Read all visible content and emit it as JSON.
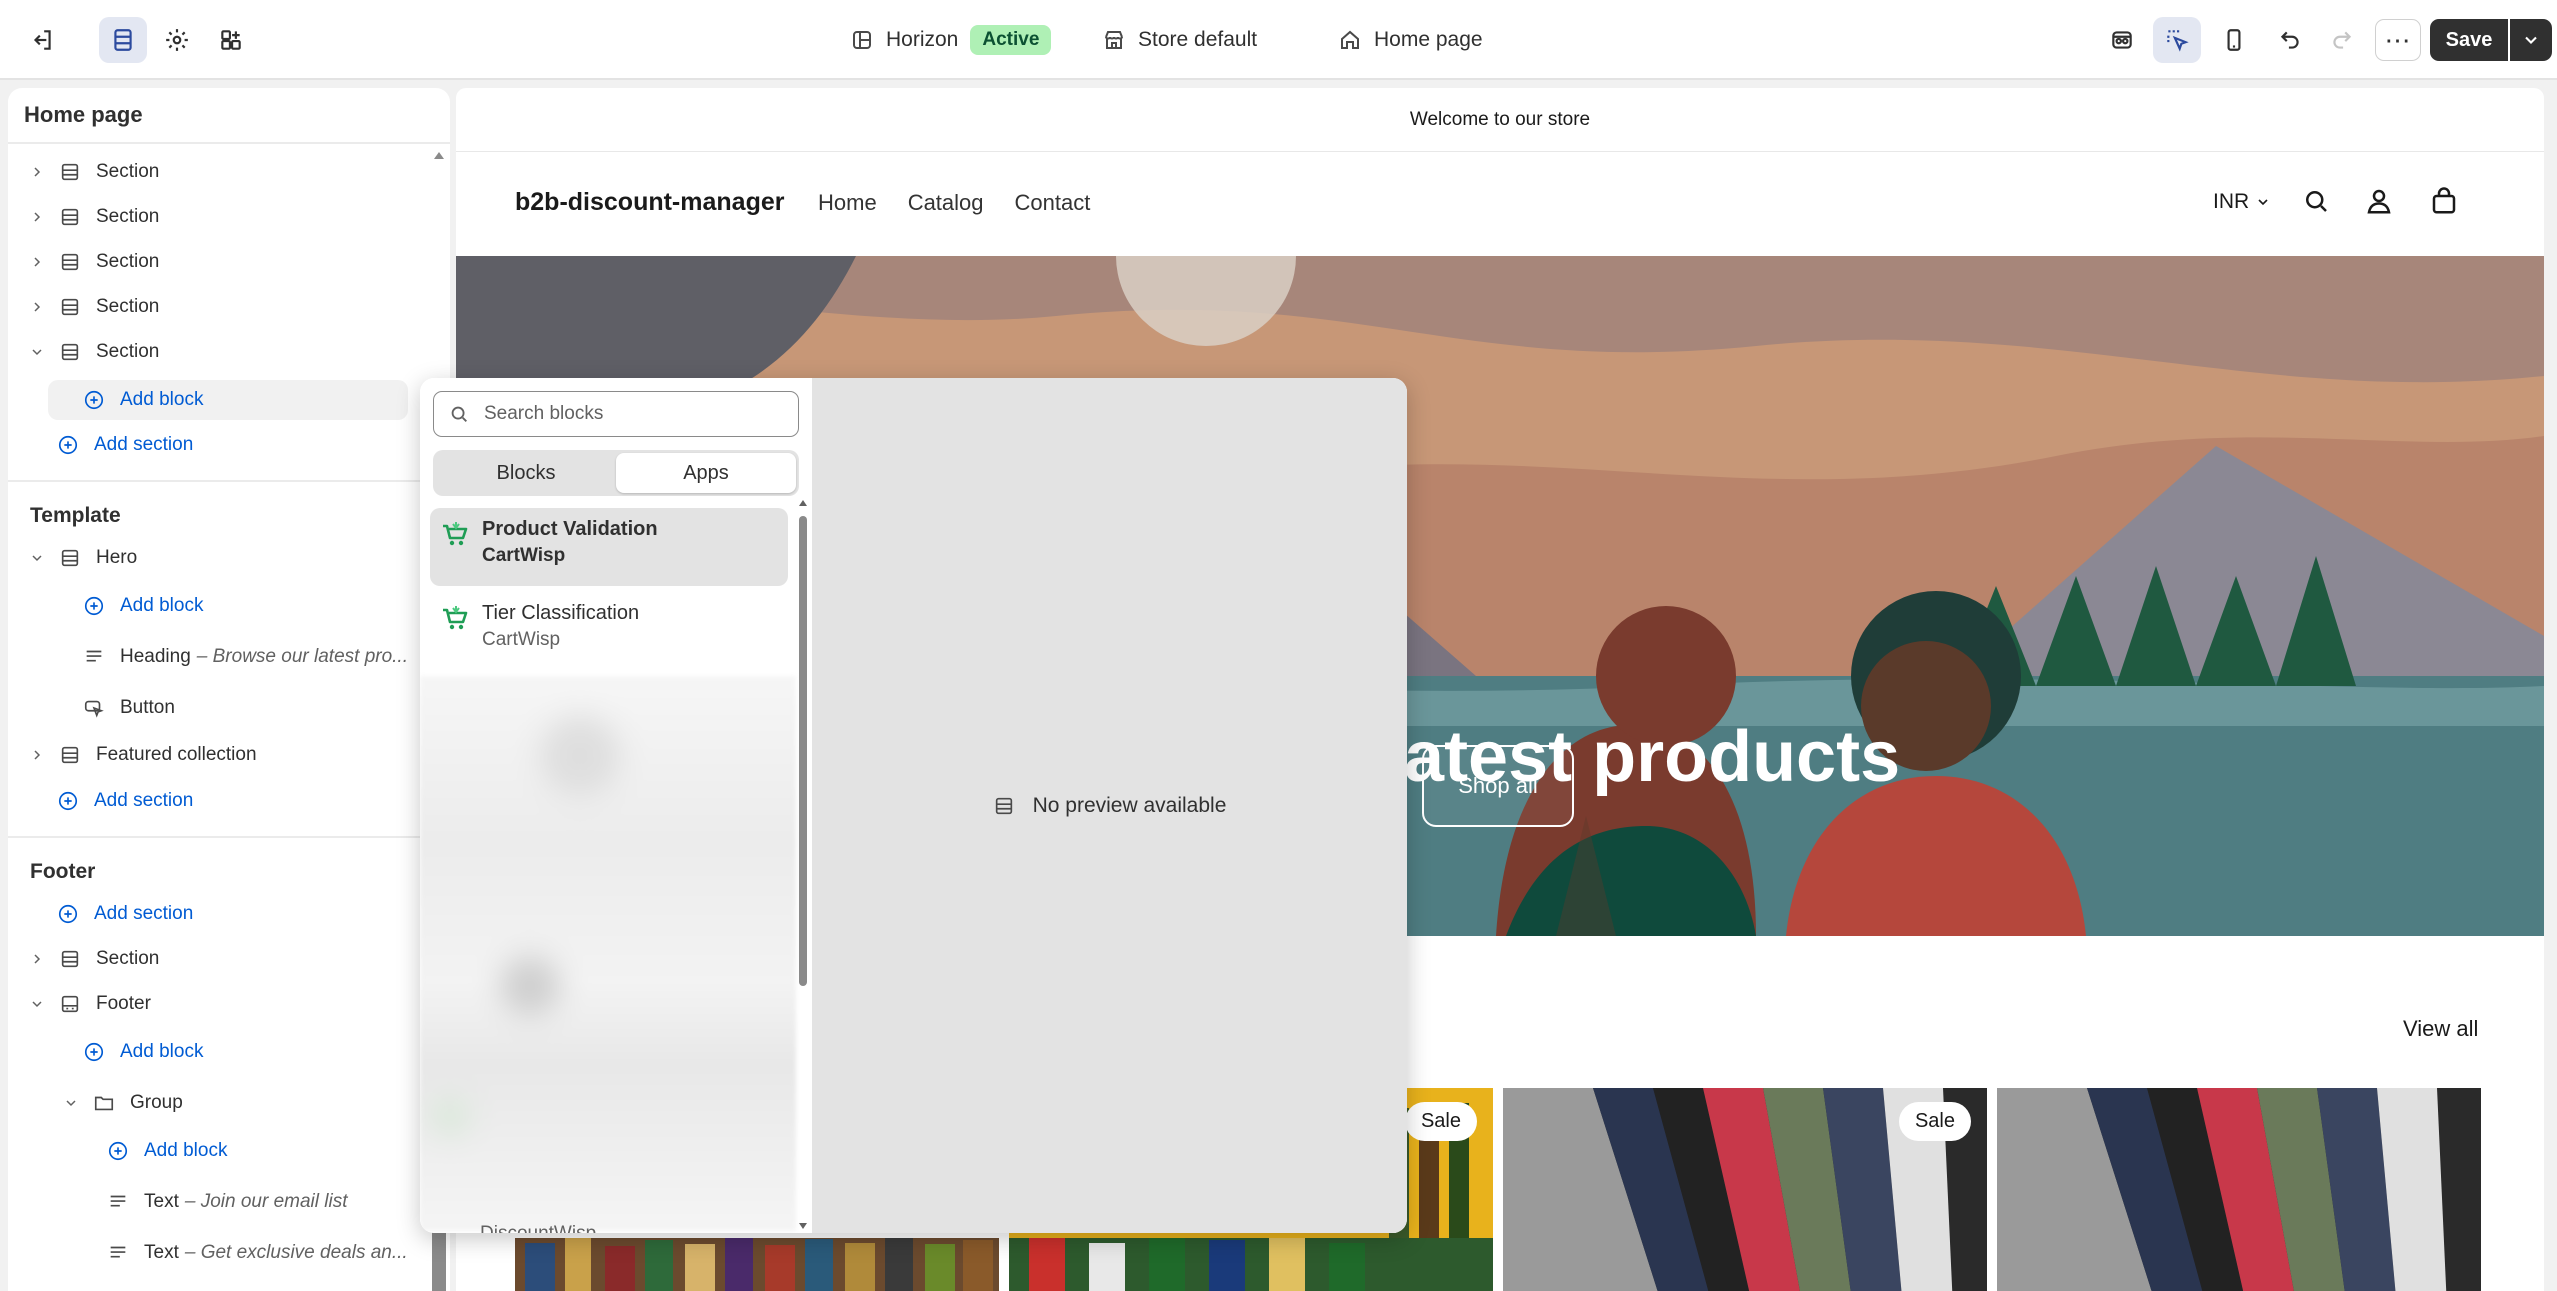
{
  "topbar": {
    "theme_name": "Horizon",
    "theme_status": "Active",
    "store_label": "Store default",
    "page_label": "Home page",
    "save_label": "Save",
    "more_label": "⋯"
  },
  "sidebar": {
    "title": "Home page",
    "header_sections": [
      {
        "label": "Section"
      },
      {
        "label": "Section"
      },
      {
        "label": "Section"
      },
      {
        "label": "Section"
      },
      {
        "label": "Section"
      }
    ],
    "add_block": "Add block",
    "add_section": "Add section",
    "template": {
      "title": "Template",
      "hero": "Hero",
      "add_block": "Add block",
      "heading_label": "Heading",
      "heading_preview": "– Browse our latest pro...",
      "button_label": "Button",
      "featured": "Featured collection",
      "add_section": "Add section"
    },
    "footer": {
      "title": "Footer",
      "add_section": "Add section",
      "section": "Section",
      "footer": "Footer",
      "add_block": "Add block",
      "group": "Group",
      "group_add_block": "Add block",
      "text1_label": "Text",
      "text1_preview": "– Join our email list",
      "text2_label": "Text",
      "text2_preview": "– Get exclusive deals an..."
    }
  },
  "preview": {
    "announcement": "Welcome to our store",
    "logo": "b2b-discount-manager",
    "nav": [
      "Home",
      "Catalog",
      "Contact"
    ],
    "currency": "INR",
    "hero_heading": "r latest products",
    "hero_button": "Shop all",
    "view_all": "View all",
    "sale_badge": "Sale"
  },
  "picker": {
    "search_placeholder": "Search blocks",
    "tabs": [
      "Blocks",
      "Apps"
    ],
    "active_tab": "Apps",
    "items": [
      {
        "title": "Product Validation",
        "app": "CartWisp"
      },
      {
        "title": "Tier Classification",
        "app": "CartWisp"
      }
    ],
    "cut_item": "DiscountWisp",
    "no_preview": "No preview available"
  }
}
